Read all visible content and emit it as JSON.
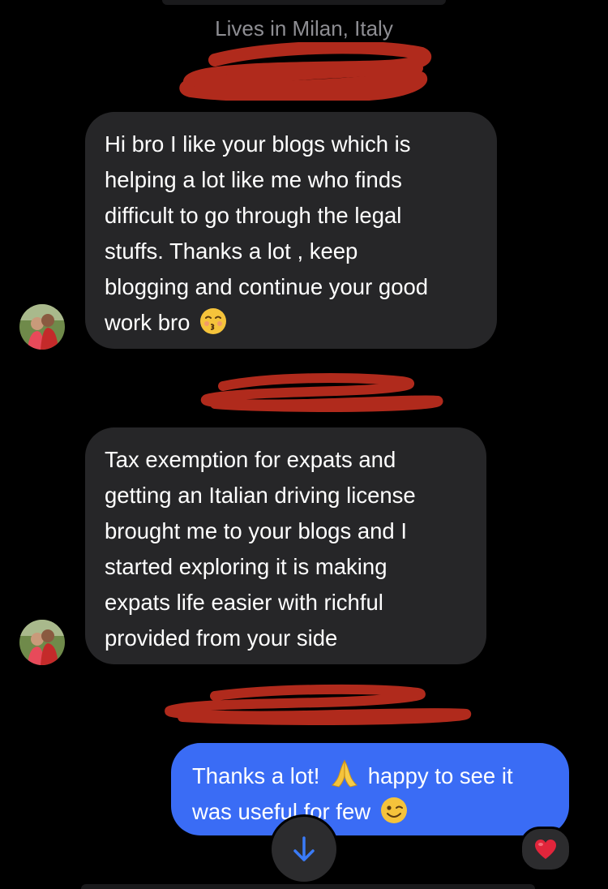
{
  "header": {
    "location": "Lives in Milan, Italy"
  },
  "messages": [
    {
      "direction": "incoming",
      "lines": [
        "Hi bro I like your blogs which is",
        "helping a lot like me who finds",
        "difficult to go through the legal",
        "stuffs. Thanks a lot , keep",
        "blogging and continue your good",
        "work bro"
      ],
      "emoji": "kissing-face"
    },
    {
      "direction": "incoming",
      "lines": [
        "Tax exemption for expats and",
        "getting an Italian  driving license",
        "brought me to your blogs and I",
        "started exploring it is making",
        "expats life easier with richful",
        "provided from your side"
      ]
    },
    {
      "direction": "outgoing",
      "lines": [
        "Thanks a lot!",
        "happy to see it",
        "was useful for few"
      ],
      "emojis": [
        "folded-hands",
        "winking-face"
      ],
      "reaction": "red-heart"
    }
  ],
  "icons": {
    "scroll_down": "arrow-down-icon",
    "reaction": "heart-icon"
  },
  "colors": {
    "incoming_bubble": "#262628",
    "outgoing_bubble": "#3a6cf5",
    "redaction": "#b02a1c",
    "scroll_arrow": "#3a7bf7"
  }
}
